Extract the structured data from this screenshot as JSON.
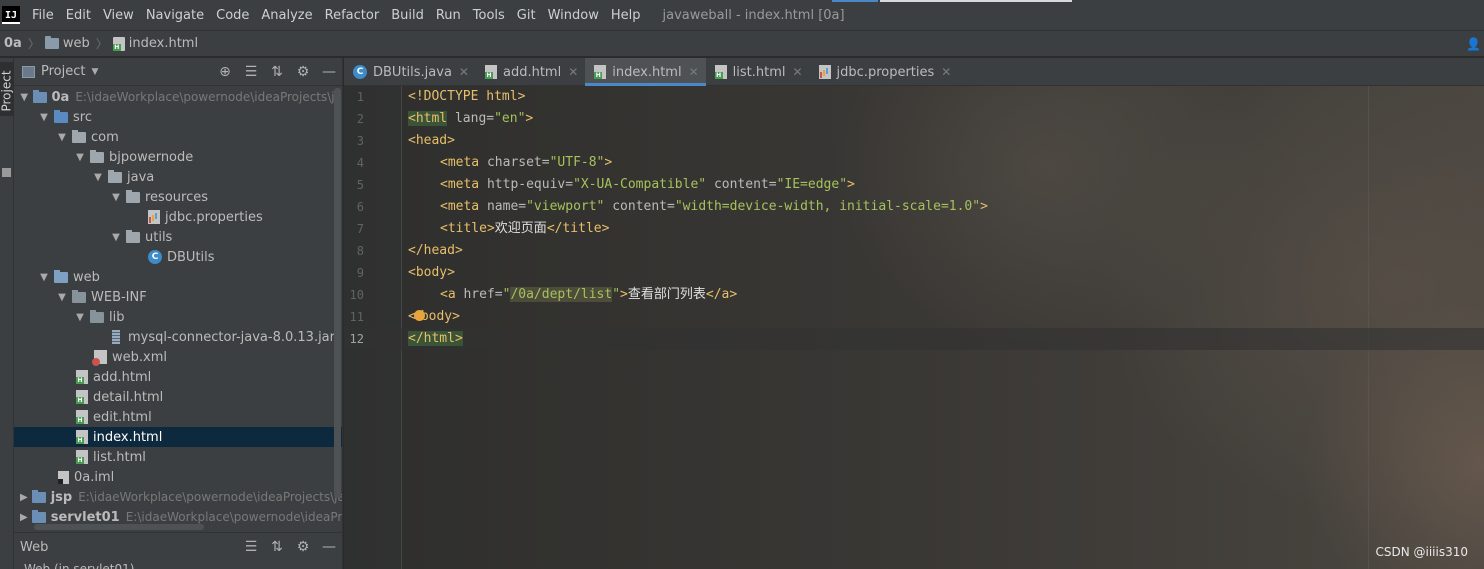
{
  "menubar": {
    "items": [
      "File",
      "Edit",
      "View",
      "Navigate",
      "Code",
      "Analyze",
      "Refactor",
      "Build",
      "Run",
      "Tools",
      "Git",
      "Window",
      "Help"
    ],
    "window_title": "javaweball - index.html [0a]"
  },
  "breadcrumb": [
    "0a",
    "web",
    "index.html"
  ],
  "project_panel": {
    "title": "Project",
    "tree": [
      {
        "label": "0a",
        "path": "E:\\idaeWorkplace\\powernode\\ideaProjects\\ja",
        "bold": true
      },
      {
        "label": "src"
      },
      {
        "label": "com"
      },
      {
        "label": "bjpowernode"
      },
      {
        "label": "java"
      },
      {
        "label": "resources"
      },
      {
        "label": "jdbc.properties"
      },
      {
        "label": "utils"
      },
      {
        "label": "DBUtils"
      },
      {
        "label": "web"
      },
      {
        "label": "WEB-INF"
      },
      {
        "label": "lib"
      },
      {
        "label": "mysql-connector-java-8.0.13.jar"
      },
      {
        "label": "web.xml"
      },
      {
        "label": "add.html"
      },
      {
        "label": "detail.html"
      },
      {
        "label": "edit.html"
      },
      {
        "label": "index.html"
      },
      {
        "label": "list.html"
      },
      {
        "label": "0a.iml"
      },
      {
        "label": "jsp",
        "path": "E:\\idaeWorkplace\\powernode\\ideaProjects\\ja",
        "bold": true
      },
      {
        "label": "servlet01",
        "path": "E:\\idaeWorkplace\\powernode\\ideaProj",
        "bold": true
      }
    ]
  },
  "web_panel": {
    "title": "Web",
    "row": "Web (in servlet01)"
  },
  "tabs": [
    {
      "label": "DBUtils.java"
    },
    {
      "label": "add.html"
    },
    {
      "label": "index.html",
      "active": true
    },
    {
      "label": "list.html"
    },
    {
      "label": "jdbc.properties"
    }
  ],
  "editor": {
    "line_numbers": [
      "1",
      "2",
      "3",
      "4",
      "5",
      "6",
      "7",
      "8",
      "9",
      "10",
      "11",
      "12"
    ],
    "current_line": 12,
    "code": {
      "l1": "<!DOCTYPE html>",
      "l2_tag": "<html",
      "l2_attr": " lang=",
      "l2_val": "\"en\"",
      "l2_end": ">",
      "l3": "<head>",
      "l4_tag": "<meta",
      "l4_attr": " charset=",
      "l4_val": "\"UTF-8\"",
      "l4_end": ">",
      "l5_tag": "<meta",
      "l5_attr1": " http-equiv=",
      "l5_val1": "\"X-UA-Compatible\"",
      "l5_attr2": " content=",
      "l5_val2": "\"IE=edge\"",
      "l5_end": ">",
      "l6_tag": "<meta",
      "l6_attr1": " name=",
      "l6_val1": "\"viewport\"",
      "l6_attr2": " content=",
      "l6_val2": "\"width=device-width, initial-scale=1.0\"",
      "l6_end": ">",
      "l7_open": "<title>",
      "l7_text": "欢迎页面",
      "l7_close": "</title>",
      "l8": "</head>",
      "l9": "<body>",
      "l10_tag": "<a",
      "l10_attr": " href=",
      "l10_q1": "\"",
      "l10_val": "/0a/dept/list",
      "l10_q2": "\"",
      "l10_gt": ">",
      "l10_text": "查看部门列表",
      "l10_close": "</a>",
      "l11_a": "<",
      "l11_b": "body>",
      "l12": "</html>"
    }
  },
  "watermark": "CSDN @iiiis310",
  "colors": {
    "accent": "#4a88c7",
    "tag": "#e8bf6a",
    "attr_value": "#a5c25c",
    "selection": "#0d293e"
  }
}
